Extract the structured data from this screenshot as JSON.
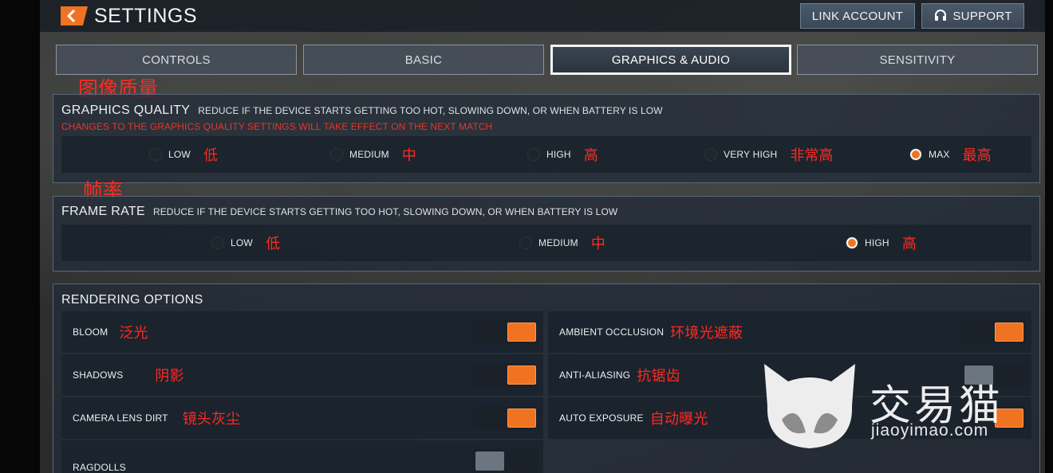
{
  "header": {
    "title": "SETTINGS",
    "link_account": "LINK ACCOUNT",
    "support": "SUPPORT"
  },
  "tabs": [
    {
      "label": "CONTROLS",
      "active": false
    },
    {
      "label": "BASIC",
      "active": false
    },
    {
      "label": "GRAPHICS & AUDIO",
      "active": true
    },
    {
      "label": "SENSITIVITY",
      "active": false
    }
  ],
  "graphics_quality": {
    "annotation": "图像质量",
    "title": "GRAPHICS QUALITY",
    "description": "REDUCE IF THE DEVICE STARTS GETTING TOO HOT, SLOWING DOWN, OR WHEN BATTERY IS LOW",
    "warning": "CHANGES TO THE GRAPHICS QUALITY SETTINGS WILL TAKE EFFECT ON THE NEXT MATCH",
    "options": [
      {
        "label": "LOW",
        "cn": "低",
        "selected": false
      },
      {
        "label": "MEDIUM",
        "cn": "中",
        "selected": false
      },
      {
        "label": "HIGH",
        "cn": "高",
        "selected": false
      },
      {
        "label": "VERY HIGH",
        "cn": "非常高",
        "selected": false
      },
      {
        "label": "MAX",
        "cn": "最高",
        "selected": true
      }
    ]
  },
  "frame_rate": {
    "annotation": "帧率",
    "title": "FRAME RATE",
    "description": "REDUCE IF THE DEVICE STARTS GETTING TOO HOT, SLOWING DOWN, OR WHEN BATTERY IS LOW",
    "options": [
      {
        "label": "LOW",
        "cn": "低",
        "selected": false
      },
      {
        "label": "MEDIUM",
        "cn": "中",
        "selected": false
      },
      {
        "label": "HIGH",
        "cn": "高",
        "selected": true
      }
    ]
  },
  "rendering": {
    "title": "RENDERING OPTIONS",
    "left": [
      {
        "label": "BLOOM",
        "cn": "泛光",
        "on": true
      },
      {
        "label": "SHADOWS",
        "cn": "阴影",
        "on": true
      },
      {
        "label": "CAMERA LENS DIRT",
        "cn": "镜头灰尘",
        "on": true
      },
      {
        "label": "RAGDOLLS",
        "cn": "",
        "on": false
      }
    ],
    "right": [
      {
        "label": "AMBIENT OCCLUSION",
        "cn": "环境光遮蔽",
        "on": true
      },
      {
        "label": "ANTI-ALIASING",
        "cn": "抗锯齿",
        "on": false
      },
      {
        "label": "AUTO EXPOSURE",
        "cn": "自动曝光",
        "on": true
      }
    ]
  },
  "watermark": {
    "text": "交易猫",
    "url": "jiaoyimao.com"
  },
  "colors": {
    "accent": "#f07322",
    "annotation_red": "#ff2a22"
  }
}
